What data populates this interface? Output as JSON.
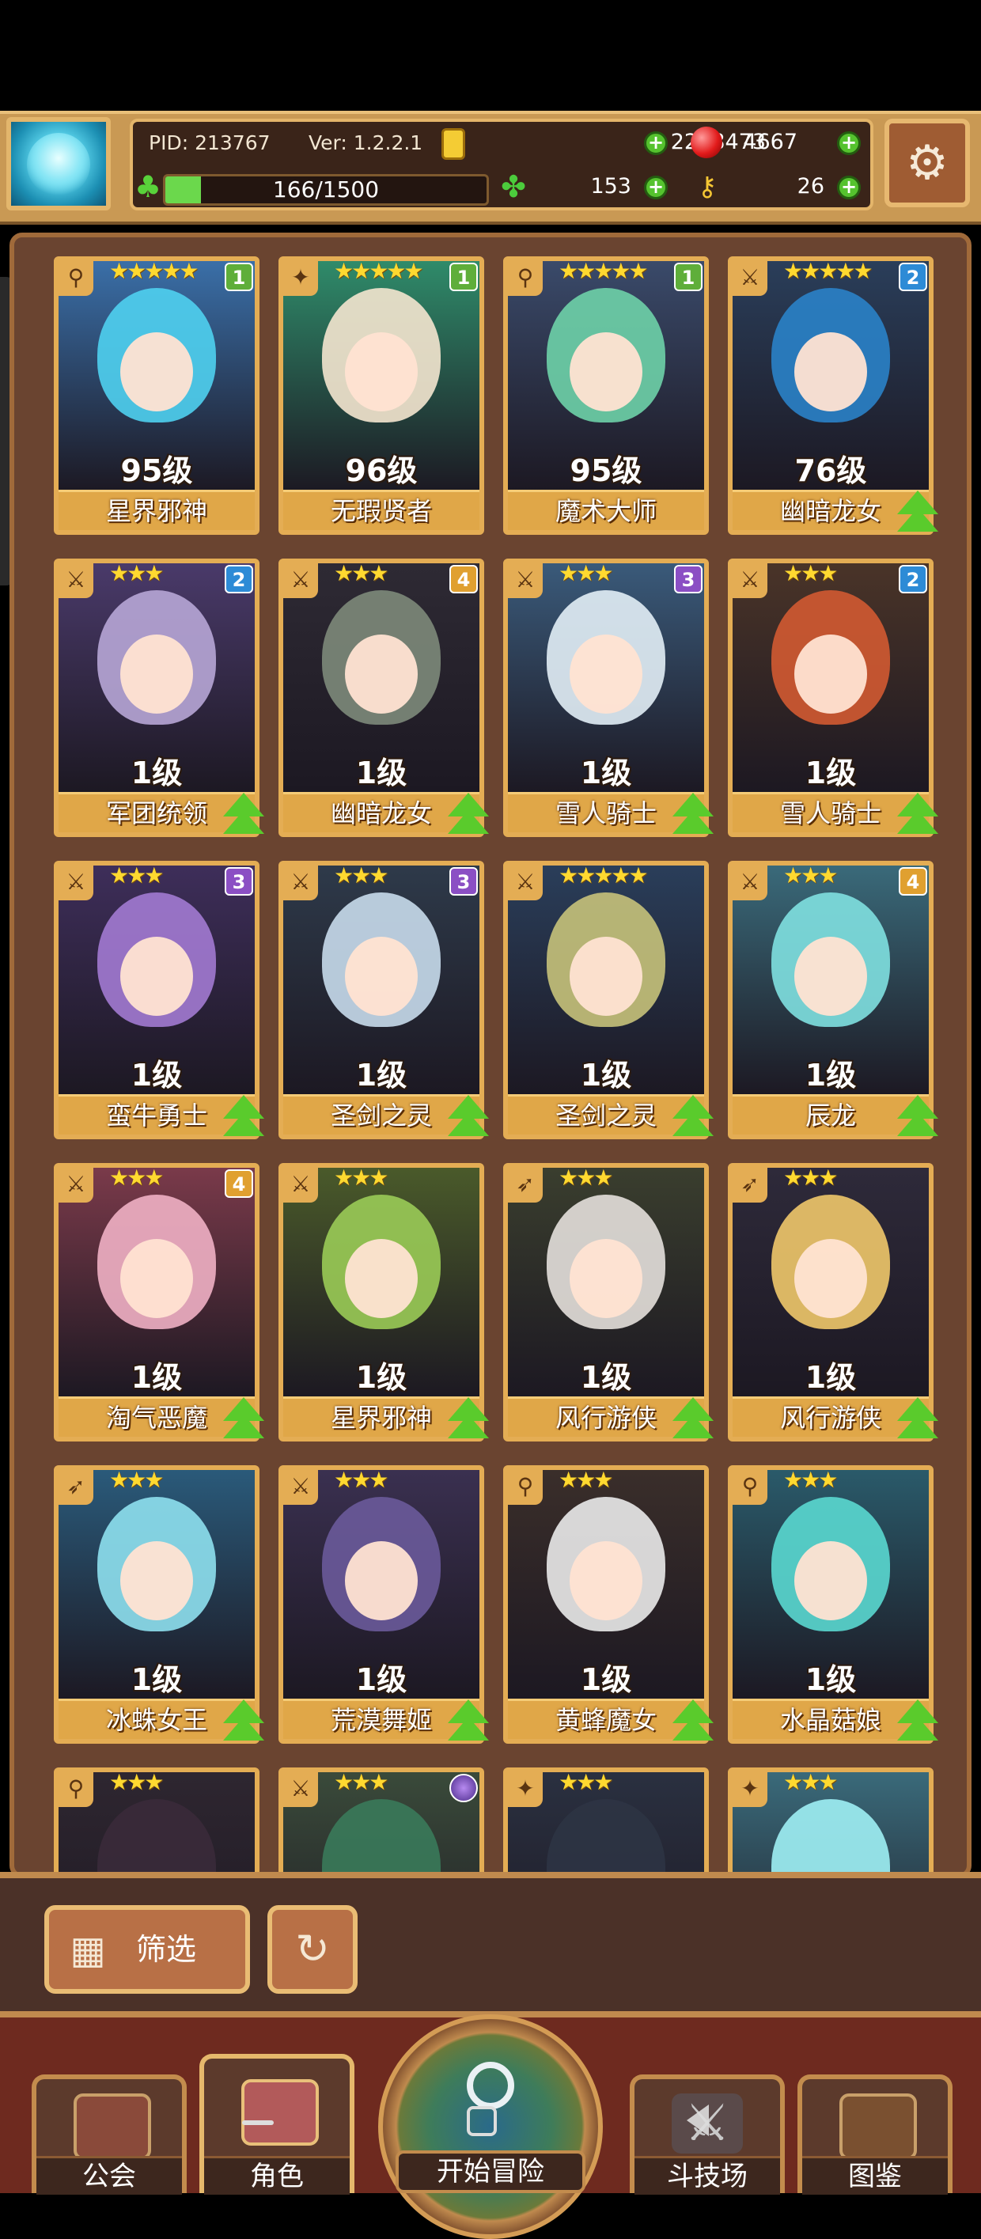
{
  "header": {
    "pid_label": "PID: 213767",
    "ver_label": "Ver: 1.2.2.1",
    "gold": "2258473",
    "gems": "4667",
    "stamina": "166/1500",
    "stamina_value": 166,
    "stamina_max": 1500,
    "clover": "153",
    "keys": "26"
  },
  "colors": {
    "card_border": "#e4ad54",
    "board_bg": "#6a4430",
    "up_arrow": "#5acb2c",
    "rank_1": "#5fae3a",
    "rank_2": "#2d8bd6",
    "rank_3": "#8b4fc4",
    "rank_4": "#e0a030"
  },
  "characters": [
    {
      "name": "星界邪神",
      "level": "95级",
      "stars": "★★★★★",
      "rank": "1",
      "class": "staff-icon",
      "upgrade": false,
      "bg": "#3a6fa8",
      "hair": "#4fd0f0"
    },
    {
      "name": "无瑕贤者",
      "level": "96级",
      "stars": "★★★★★",
      "rank": "1",
      "class": "star-icon",
      "upgrade": false,
      "bg": "#2f8b6a",
      "hair": "#f4e6cf"
    },
    {
      "name": "魔术大师",
      "level": "95级",
      "stars": "★★★★★",
      "rank": "1",
      "class": "staff-icon",
      "upgrade": false,
      "bg": "#3a4a6a",
      "hair": "#6ed2a8"
    },
    {
      "name": "幽暗龙女",
      "level": "76级",
      "stars": "★★★★★",
      "rank": "2",
      "class": "sword-icon",
      "upgrade": true,
      "bg": "#2a3e5a",
      "hair": "#2a82c8"
    },
    {
      "name": "军团统领",
      "level": "1级",
      "stars": "★★★",
      "rank": "2",
      "class": "sword-icon",
      "upgrade": true,
      "bg": "#4a3a6a",
      "hair": "#b7a6d6"
    },
    {
      "name": "幽暗龙女",
      "level": "1级",
      "stars": "★★★",
      "rank": "4",
      "class": "sword-icon",
      "upgrade": true,
      "bg": "#2e2a34",
      "hair": "#7d8a7a"
    },
    {
      "name": "雪人骑士",
      "level": "1级",
      "stars": "★★★",
      "rank": "3",
      "class": "sword-icon",
      "upgrade": true,
      "bg": "#3a5a7a",
      "hair": "#e2eef6"
    },
    {
      "name": "雪人骑士",
      "level": "1级",
      "stars": "★★★",
      "rank": "2",
      "class": "sword-icon",
      "upgrade": true,
      "bg": "#4a3428",
      "hair": "#d25a32"
    },
    {
      "name": "蛮牛勇士",
      "level": "1级",
      "stars": "★★★",
      "rank": "3",
      "class": "sword-icon",
      "upgrade": true,
      "bg": "#3e2e5a",
      "hair": "#a27ad2"
    },
    {
      "name": "圣剑之灵",
      "level": "1级",
      "stars": "★★★",
      "rank": "3",
      "class": "sword-icon",
      "upgrade": true,
      "bg": "#2e3a4a",
      "hair": "#c8dcec"
    },
    {
      "name": "圣剑之灵",
      "level": "1级",
      "stars": "★★★★★",
      "rank": "",
      "class": "sword-icon",
      "upgrade": true,
      "bg": "#2a3e5a",
      "hair": "#c6c27a"
    },
    {
      "name": "辰龙",
      "level": "1级",
      "stars": "★★★",
      "rank": "4",
      "class": "sword-icon",
      "upgrade": true,
      "bg": "#3a6a7a",
      "hair": "#7fe0e0"
    },
    {
      "name": "淘气恶魔",
      "level": "1级",
      "stars": "★★★",
      "rank": "4",
      "class": "sword-icon",
      "upgrade": true,
      "bg": "#7a3a4a",
      "hair": "#f0b0c4"
    },
    {
      "name": "星界邪神",
      "level": "1级",
      "stars": "★★★",
      "rank": "",
      "class": "sword-icon",
      "upgrade": true,
      "bg": "#4a5a2a",
      "hair": "#9acb56"
    },
    {
      "name": "风行游侠",
      "level": "1级",
      "stars": "★★★",
      "rank": "",
      "class": "bow-icon",
      "upgrade": true,
      "bg": "#3a3e2e",
      "hair": "#e4e0dc"
    },
    {
      "name": "风行游侠",
      "level": "1级",
      "stars": "★★★",
      "rank": "",
      "class": "bow-icon",
      "upgrade": true,
      "bg": "#2e2a3a",
      "hair": "#f0c86a"
    },
    {
      "name": "冰蛛女王",
      "level": "1级",
      "stars": "★★★",
      "rank": "",
      "class": "bow-icon",
      "upgrade": true,
      "bg": "#2a5a7a",
      "hair": "#8ee0ee"
    },
    {
      "name": "荒漠舞姬",
      "level": "1级",
      "stars": "★★★",
      "rank": "",
      "class": "sword-icon",
      "upgrade": true,
      "bg": "#3a3050",
      "hair": "#6a5a9a"
    },
    {
      "name": "黄蜂魔女",
      "level": "1级",
      "stars": "★★★",
      "rank": "",
      "class": "staff-icon",
      "upgrade": true,
      "bg": "#3a2e2a",
      "hair": "#eaeaea"
    },
    {
      "name": "水晶菇娘",
      "level": "1级",
      "stars": "★★★",
      "rank": "",
      "class": "staff-icon",
      "upgrade": true,
      "bg": "#2a5a6a",
      "hair": "#5ad8d0"
    },
    {
      "name": "",
      "level": "",
      "stars": "★★★",
      "rank": "",
      "class": "staff-icon",
      "upgrade": false,
      "bg": "#2e2630",
      "hair": "#3a2a3a"
    },
    {
      "name": "",
      "level": "",
      "stars": "★★★",
      "rank": "gem",
      "class": "sword-icon",
      "upgrade": false,
      "bg": "#3a4a3a",
      "hair": "#3a7a5a"
    },
    {
      "name": "",
      "level": "",
      "stars": "★★★",
      "rank": "",
      "class": "star-icon",
      "upgrade": false,
      "bg": "#2a3040",
      "hair": "#2e3444"
    },
    {
      "name": "",
      "level": "",
      "stars": "★★★",
      "rank": "",
      "class": "star-icon",
      "upgrade": false,
      "bg": "#3a6a7a",
      "hair": "#9ef0f4"
    }
  ],
  "controls": {
    "filter_label": "筛选",
    "filter_icon": "grid-icon",
    "reset_icon": "refresh-icon"
  },
  "nav": {
    "guild": "公会",
    "character": "角色",
    "adventure": "开始冒险",
    "arena": "斗技场",
    "codex": "图鉴"
  }
}
